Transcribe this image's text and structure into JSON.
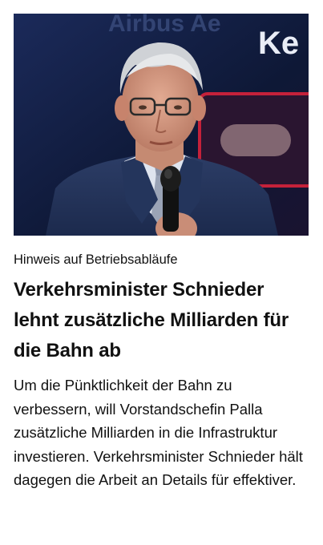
{
  "article": {
    "image": {
      "description_icon": "portrait-photo",
      "background_text": "Ke"
    },
    "kicker": "Hinweis auf Betriebsabläufe",
    "headline": "Verkehrsminister Schnieder lehnt zusätzliche Milliarden für die Bahn ab",
    "teaser": "Um die Pünktlichkeit der Bahn zu verbessern, will Vorstandschefin Palla zusätzliche Milliarden in die Infrastruktur investieren. Verkehrsminister Schnieder hält dagegen die Arbeit an Details für effektiver."
  }
}
